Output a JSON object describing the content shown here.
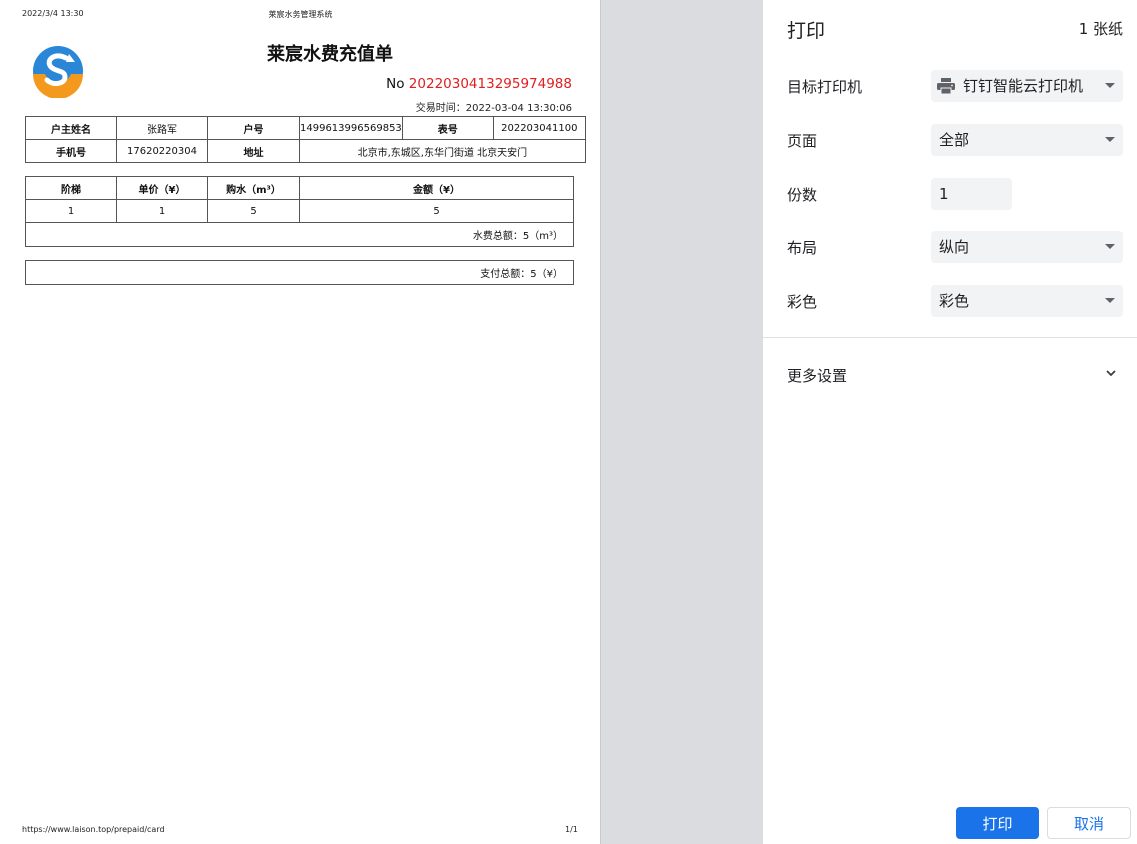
{
  "preview": {
    "header_date": "2022/3/4 13:30",
    "header_title": "莱宸水务管理系统",
    "footer_url": "https://www.laison.top/prepaid/card",
    "footer_page": "1/1",
    "doc_title": "莱宸水费充值单",
    "no_label": "No",
    "no_value": "2022030413295974988",
    "trade_time": "交易时间：2022-03-04 13:30:06",
    "info": {
      "owner_label": "户主姓名",
      "owner_value": "张路军",
      "account_label": "户号",
      "account_value": "1499613996569853",
      "meter_label": "表号",
      "meter_value": "202203041100",
      "phone_label": "手机号",
      "phone_value": "17620220304",
      "address_label": "地址",
      "address_value": "北京市,东城区,东华门街道 北京天安门"
    },
    "detail": {
      "col_tier": "阶梯",
      "col_price": "单价（¥）",
      "col_water": "购水（m³）",
      "col_amount": "金额（¥）",
      "tier": "1",
      "price": "1",
      "water": "5",
      "amount": "5",
      "water_total": "水费总额：5（m³）"
    },
    "pay_total": "支付总额：5（¥）"
  },
  "settings": {
    "title": "打印",
    "sheets": "1 张纸",
    "printer_label": "目标打印机",
    "printer_value": "钉钉智能云打印机",
    "pages_label": "页面",
    "pages_value": "全部",
    "copies_label": "份数",
    "copies_value": "1",
    "layout_label": "布局",
    "layout_value": "纵向",
    "color_label": "彩色",
    "color_value": "彩色",
    "more_label": "更多设置",
    "print_button": "打印",
    "cancel_button": "取消"
  },
  "colors": {
    "accent": "#1a73e8",
    "number_red": "#e02020",
    "logo_blue": "#2a86d6",
    "logo_orange": "#f39a1e"
  },
  "icons": {
    "printer": "printer-icon",
    "dropdown": "dropdown-arrow-icon",
    "expand": "chevron-down-icon",
    "logo": "logo-icon"
  }
}
